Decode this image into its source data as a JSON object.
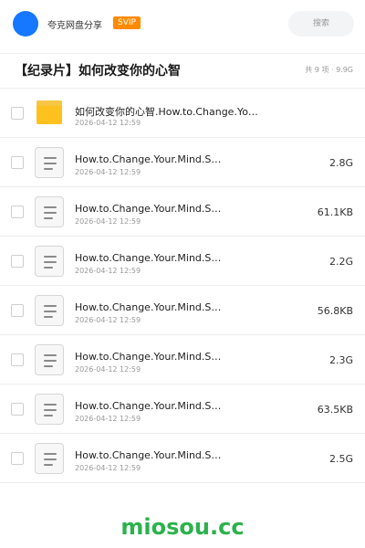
{
  "header": {
    "owner_name": "夸克网盘分享",
    "badge": "SVIP",
    "search_label": "搜索"
  },
  "folder": {
    "title": "【纪录片】如何改变你的心智",
    "summary": "共 9 项 · 9.9G"
  },
  "items": [
    {
      "type": "folder",
      "name": "如何改变你的心智.How.to.Change.Yo…",
      "date": "2026-04-12 12:59",
      "size": ""
    },
    {
      "type": "file",
      "name": "How.to.Change.Your.Mind.S…",
      "date": "2026-04-12 12:59",
      "size": "2.8G"
    },
    {
      "type": "file",
      "name": "How.to.Change.Your.Mind.S…",
      "date": "2026-04-12 12:59",
      "size": "61.1KB"
    },
    {
      "type": "file",
      "name": "How.to.Change.Your.Mind.S…",
      "date": "2026-04-12 12:59",
      "size": "2.2G"
    },
    {
      "type": "file",
      "name": "How.to.Change.Your.Mind.S…",
      "date": "2026-04-12 12:59",
      "size": "56.8KB"
    },
    {
      "type": "file",
      "name": "How.to.Change.Your.Mind.S…",
      "date": "2026-04-12 12:59",
      "size": "2.3G"
    },
    {
      "type": "file",
      "name": "How.to.Change.Your.Mind.S…",
      "date": "2026-04-12 12:59",
      "size": "63.5KB"
    },
    {
      "type": "file",
      "name": "How.to.Change.Your.Mind.S…",
      "date": "2026-04-12 12:59",
      "size": "2.5G"
    }
  ],
  "watermark": "miosou.cc",
  "colors": {
    "avatar": "#1677ff",
    "badge": "#ff8a00",
    "folder": "#ffc11e",
    "watermark": "#2bb24c"
  }
}
